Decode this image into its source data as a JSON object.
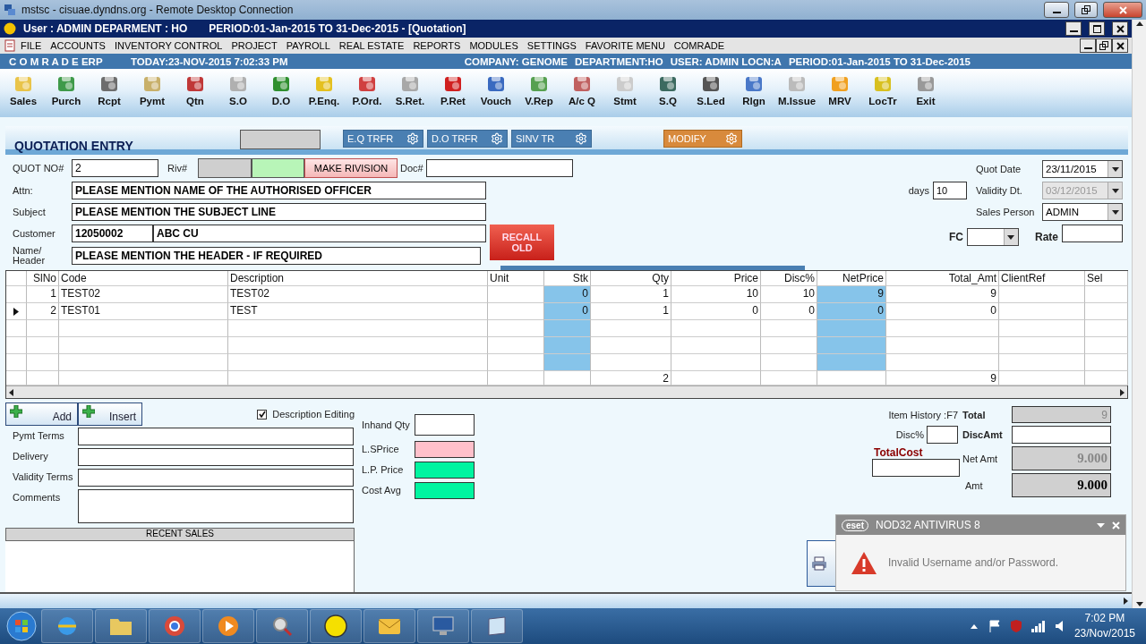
{
  "rdp_window": {
    "title": "mstsc - cisuae.dyndns.org - Remote Desktop Connection"
  },
  "app_window": {
    "title_parts": [
      "User : ADMIN  DEPARMENT : HO",
      "PERIOD:01-Jan-2015 TO 31-Dec-2015 - [Quotation]"
    ]
  },
  "menu": [
    "FILE",
    "ACCOUNTS",
    "INVENTORY CONTROL",
    "PROJECT",
    "PAYROLL",
    "REAL ESTATE",
    "REPORTS",
    "MODULES",
    "SETTINGS",
    "FAVORITE MENU",
    "COMRADE"
  ],
  "info_bar": {
    "brand": "C O M R A D E ERP",
    "today": "TODAY:23-NOV-2015 7:02:33 PM",
    "company": "COMPANY: GENOME",
    "department": "DEPARTMENT:HO",
    "user": "USER: ADMIN LOCN:A",
    "period": "PERIOD:01-Jan-2015 TO 31-Dec-2015"
  },
  "toolbar": [
    "Sales",
    "Purch",
    "Rcpt",
    "Pymt",
    "Qtn",
    "S.O",
    "D.O",
    "P.Enq.",
    "P.Ord.",
    "S.Ret.",
    "P.Ret",
    "Vouch",
    "V.Rep",
    "A/c Q",
    "Stmt",
    "S.Q",
    "S.Led",
    "Rlgn",
    "M.Issue",
    "MRV",
    "LocTr",
    "Exit"
  ],
  "form": {
    "title": "QUOTATION ENTRY",
    "actions": [
      {
        "label": "E.Q TRFR",
        "kind": "transfer"
      },
      {
        "label": "D.O TRFR",
        "kind": "transfer"
      },
      {
        "label": "SINV TR",
        "kind": "transfer"
      },
      {
        "label": "MODIFY",
        "kind": "modify"
      }
    ],
    "quot_no": {
      "label": "QUOT NO#",
      "value": "2"
    },
    "riv": {
      "label": "Riv#"
    },
    "make_revision": "MAKE RIVISION",
    "doc": {
      "label": "Doc#"
    },
    "attn": {
      "label": "Attn:",
      "value": "PLEASE MENTION NAME OF THE AUTHORISED OFFICER"
    },
    "subject": {
      "label": "Subject",
      "value": "PLEASE MENTION THE SUBJECT LINE"
    },
    "customer": {
      "label": "Customer",
      "code": "12050002",
      "name": "ABC CU"
    },
    "header": {
      "label_lines": [
        "Name/",
        "Header"
      ],
      "value": "PLEASE MENTION THE HEADER - IF REQUIRED"
    },
    "recall": "RECALL OLD",
    "quot_date": {
      "label": "Quot Date",
      "value": "23/11/2015"
    },
    "days": {
      "label": "days",
      "value": "10"
    },
    "validity": {
      "label": "Validity Dt.",
      "value": "03/12/2015",
      "disabled": true
    },
    "sales_person": {
      "label": "Sales Person",
      "value": "ADMIN"
    },
    "fc": {
      "label": "FC"
    },
    "rate": {
      "label": "Rate"
    }
  },
  "grid": {
    "columns": [
      {
        "label": "SlNo",
        "shaded": false
      },
      {
        "label": "Code",
        "shaded": false
      },
      {
        "label": "Description",
        "shaded": false
      },
      {
        "label": "Unit",
        "shaded": false
      },
      {
        "label": "Stk",
        "shaded": true
      },
      {
        "label": "Qty",
        "shaded": false
      },
      {
        "label": "Price",
        "shaded": false
      },
      {
        "label": "Disc%",
        "shaded": false
      },
      {
        "label": "NetPrice",
        "shaded": true
      },
      {
        "label": "Total_Amt",
        "shaded": false
      },
      {
        "label": "ClientRef",
        "shaded": false
      },
      {
        "label": "Sel",
        "shaded": false
      }
    ],
    "rows": [
      {
        "selected": false,
        "sl_no": "1",
        "code": "TEST02",
        "description": "TEST02",
        "stk": "0",
        "qty": "1",
        "price": "10",
        "disc": "10",
        "net_price": "9",
        "total_amt": "9"
      },
      {
        "selected": true,
        "sl_no": "2",
        "code": "TEST01",
        "description": "TEST",
        "stk": "0",
        "qty": "1",
        "price": "0",
        "disc": "0",
        "net_price": "0",
        "total_amt": "0"
      }
    ],
    "totals": {
      "qty": "2",
      "total_amt": "9"
    }
  },
  "bottom": {
    "buttons": [
      "Add",
      "Insert"
    ],
    "description_editing": {
      "label": "Description Editing",
      "checked": true
    },
    "terms": [
      {
        "label": "Pymt Terms",
        "kind": "line"
      },
      {
        "label": "Delivery",
        "kind": "line"
      },
      {
        "label": "Validity Terms",
        "kind": "line"
      },
      {
        "label": "Comments",
        "kind": "multiline"
      }
    ],
    "recent_sales": {
      "title": "RECENT SALES"
    }
  },
  "stock_info": [
    {
      "label": "Inhand Qty",
      "color": "#ffffff"
    },
    {
      "label": "L.SPrice",
      "color": "#ffc0cb"
    },
    {
      "label": "L.P. Price",
      "color": "#00f5a0"
    },
    {
      "label": "Cost Avg",
      "color": "#00f5a0"
    }
  ],
  "summary": {
    "item_history": "Item History :F7",
    "total": {
      "label": "Total",
      "value": "9"
    },
    "disc_pct": {
      "label": "Disc%"
    },
    "disc_amt": {
      "label": "DiscAmt"
    },
    "total_cost": {
      "label": "TotalCost"
    },
    "net_amt": {
      "label": "Net Amt",
      "value": "9.000"
    },
    "amt": {
      "label": "Amt",
      "value": "9.000"
    }
  },
  "notification": {
    "logo": "eset",
    "title": "NOD32 ANTIVIRUS 8",
    "message": "Invalid Username and/or Password."
  },
  "taskbar": {
    "time": "7:02 PM",
    "date": "23/Nov/2015"
  }
}
